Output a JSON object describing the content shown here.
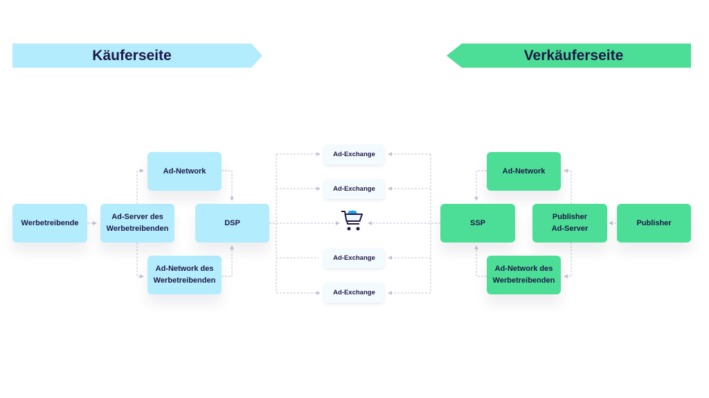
{
  "buyer_side": {
    "banner": "Käuferseite",
    "color": "#b2ecfd",
    "nodes": {
      "advertiser": "Werbetreibende",
      "ad_server": "Ad-Server des\nWerbetreibenden",
      "ad_network": "Ad-Network",
      "advertiser_ad_network": "Ad-Network des\nWerbetreibenden",
      "dsp": "DSP"
    }
  },
  "seller_side": {
    "banner": "Verkäuferseite",
    "color": "#4cde96",
    "nodes": {
      "ad_network": "Ad-Network",
      "ssp": "SSP",
      "publisher_ad_server": "Publisher\nAd-Server",
      "publisher": "Publisher",
      "advertiser_ad_network": "Ad-Network des\nWerbetreibenden"
    }
  },
  "exchange": {
    "nodes": [
      "Ad-Exchange",
      "Ad-Exchange",
      "Ad-Exchange",
      "Ad-Exchange"
    ],
    "center_icon": "shopping-cart-gear-icon"
  },
  "colors": {
    "text": "#1f1847",
    "connector": "#c4c2d6",
    "cart_gear": "#1aa3f0"
  }
}
